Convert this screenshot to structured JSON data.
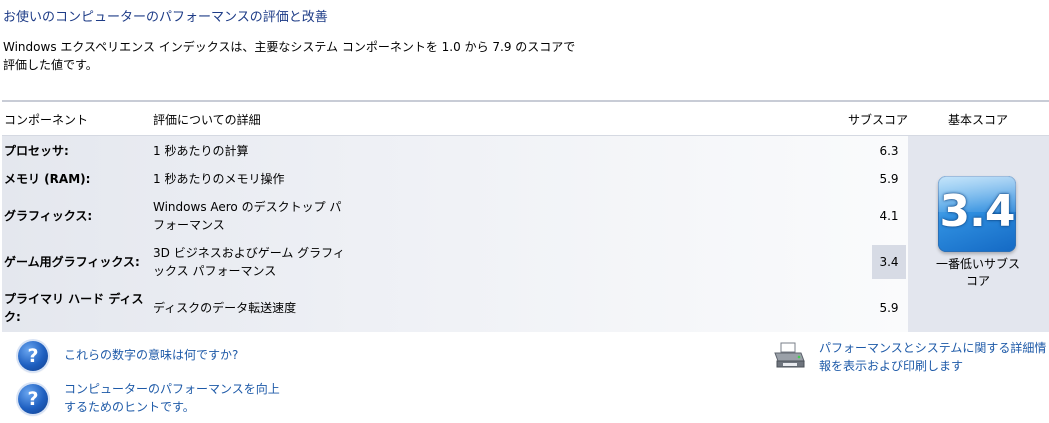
{
  "header": {
    "title": "お使いのコンピューターのパフォーマンスの評価と改善",
    "description_line1": "Windows エクスペリエンス インデックスは、主要なシステム コンポーネントを 1.0 から 7.9 のスコアで",
    "description_line2": "評価した値です。"
  },
  "table": {
    "columns": {
      "component": "コンポーネント",
      "detail": "評価についての詳細",
      "subscore": "サブスコア",
      "basescore": "基本スコア"
    },
    "rows": [
      {
        "name": "プロセッサ:",
        "detail_line1": "1 秒あたりの計算",
        "detail_line2": "",
        "score": "6.3"
      },
      {
        "name": "メモリ (RAM):",
        "detail_line1": "1 秒あたりのメモリ操作",
        "detail_line2": "",
        "score": "5.9"
      },
      {
        "name": "グラフィックス:",
        "detail_line1": "Windows Aero のデスクトップ パ",
        "detail_line2": "フォーマンス",
        "score": "4.1"
      },
      {
        "name": "ゲーム用グラフィックス:",
        "detail_line1": "3D ビジネスおよびゲーム グラフィ",
        "detail_line2": "ックス パフォーマンス",
        "score": "3.4"
      },
      {
        "name_line1": "プライマリ ハード ディス",
        "name_line2": "ク:",
        "detail_line1": "ディスクのデータ転送速度",
        "detail_line2": "",
        "score": "5.9"
      }
    ],
    "base_score": "3.4",
    "base_label_line1": "一番低いサブス",
    "base_label_line2": "コア"
  },
  "links": {
    "meaning": "これらの数字の意味は何ですか?",
    "tips_line1": "コンピューターのパフォーマンスを向上",
    "tips_line2": "するためのヒントです。",
    "print_line1": "パフォーマンスとシステムに関する詳細情",
    "print_line2": "報を表示および印刷します"
  },
  "icons": {
    "help": "question-icon",
    "print": "printer-icon"
  },
  "colors": {
    "link": "#1e5aa8",
    "title": "#1e3c87",
    "badge": "#2f8fe0"
  }
}
